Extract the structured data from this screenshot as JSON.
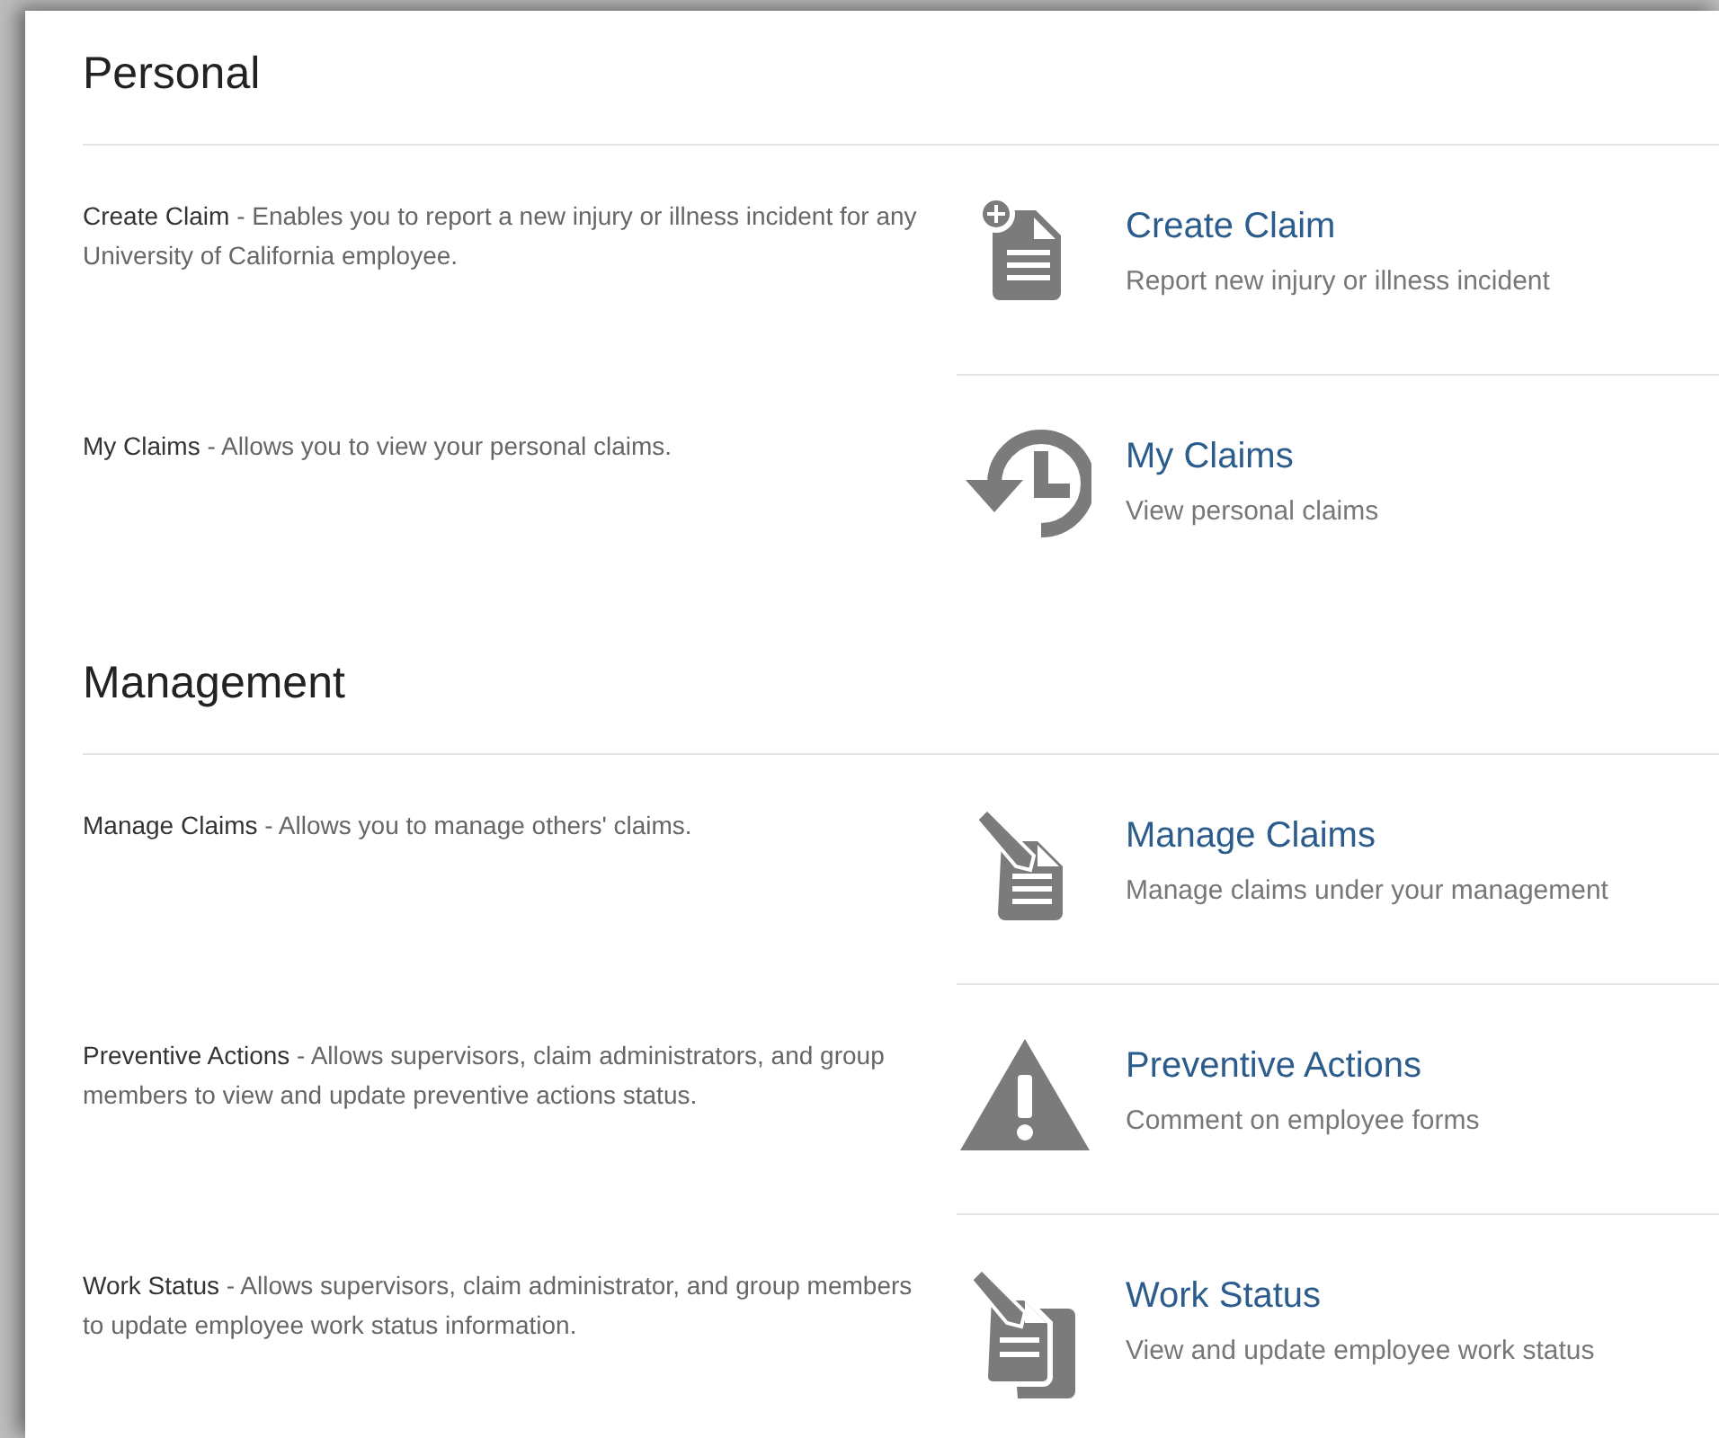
{
  "sections": [
    {
      "title": "Personal",
      "items": [
        {
          "term": "Create Claim",
          "description": " - Enables you to report a new injury or illness incident for any University of California employee.",
          "title": "Create Claim",
          "subtitle": "Report new injury or illness incident",
          "kind": "create"
        },
        {
          "term": "My Claims",
          "description": " - Allows you to view your personal claims.",
          "title": "My Claims",
          "subtitle": "View personal claims",
          "kind": "history"
        }
      ]
    },
    {
      "title": "Management",
      "items": [
        {
          "term": "Manage Claims",
          "description": " - Allows you to manage others' claims.",
          "title": "Manage Claims",
          "subtitle": "Manage claims under your management",
          "kind": "manage"
        },
        {
          "term": "Preventive Actions",
          "description": " - Allows supervisors, claim administrators, and group members to view and update preventive actions status.",
          "title": "Preventive Actions",
          "subtitle": "Comment on employee forms",
          "kind": "warning"
        },
        {
          "term": "Work Status",
          "description": " - Allows supervisors, claim administrator, and group members to update employee work status information.",
          "title": "Work Status",
          "subtitle": "View and update employee work status",
          "kind": "workstatus"
        }
      ]
    }
  ]
}
